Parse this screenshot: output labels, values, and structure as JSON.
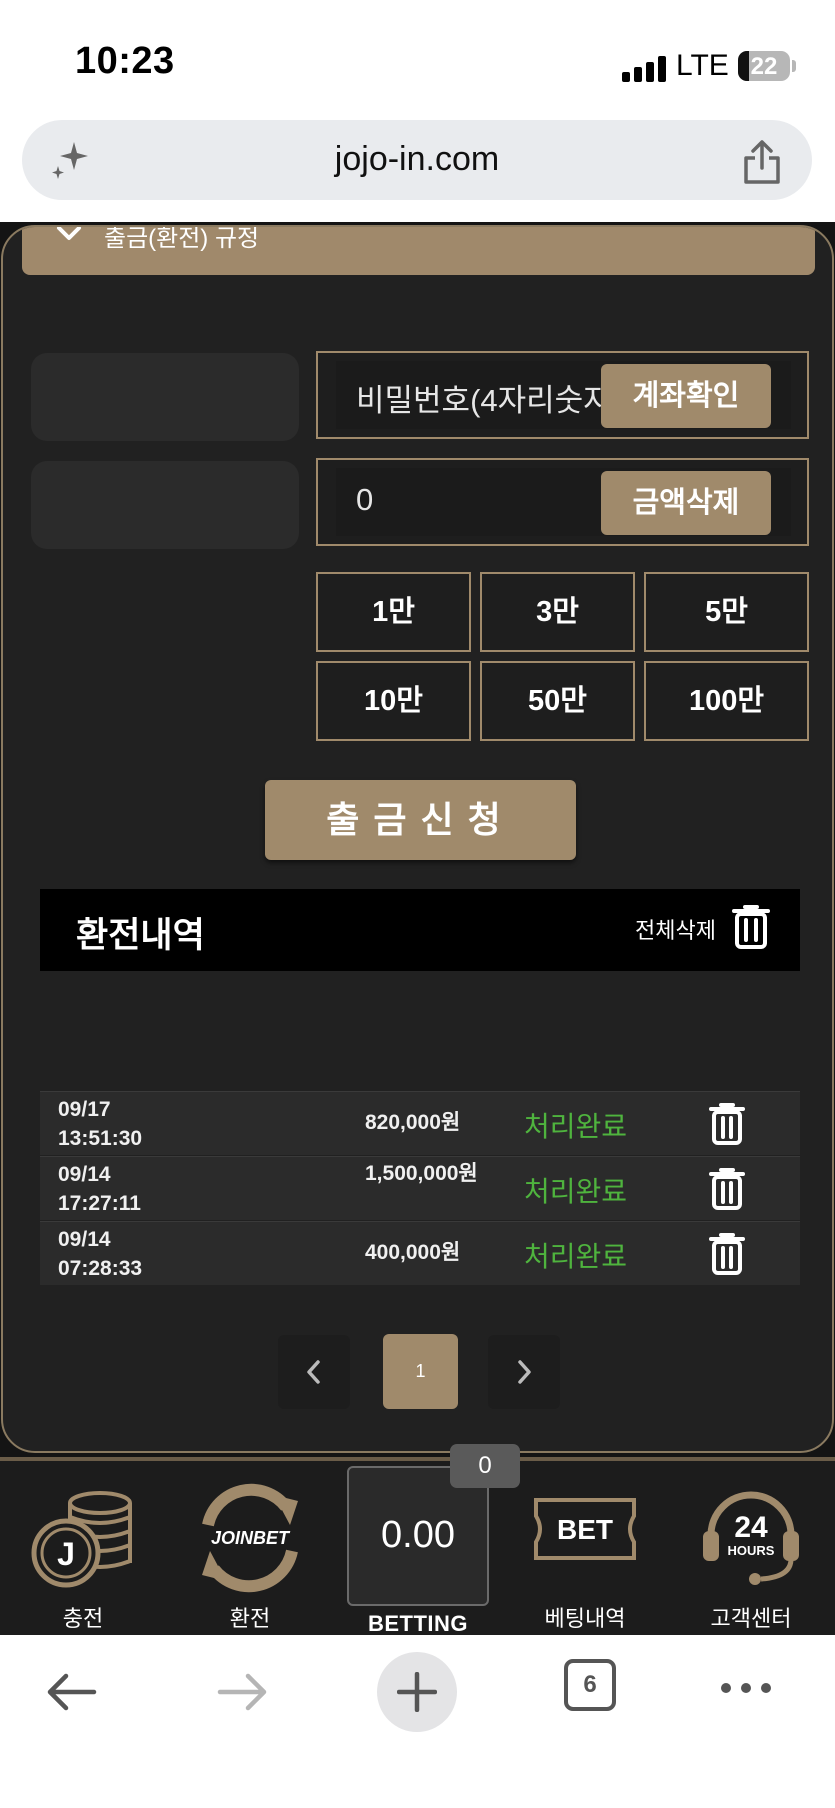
{
  "status_bar": {
    "time": "10:23",
    "network": "LTE",
    "battery": "22",
    "battery_level": 0.22
  },
  "browser": {
    "url": "jojo-in.com"
  },
  "withdraw": {
    "rules_toggle_label": "출금(환전) 규정",
    "password_placeholder": "비밀번호(4자리숫자)",
    "account_check_label": "계좌확인",
    "amount_value": "0",
    "amount_clear_label": "금액삭제",
    "amount_buttons": [
      "1만",
      "3만",
      "5만",
      "10만",
      "50만",
      "100만"
    ],
    "submit_label": "출금신청"
  },
  "history": {
    "title": "환전내역",
    "delete_all_label": "전체삭제",
    "rows": [
      {
        "date": "09/17",
        "time": "13:51:30",
        "amount": "820,000원",
        "status": "처리완료"
      },
      {
        "date": "09/14",
        "time": "17:27:11",
        "amount": "1,500,000원",
        "status": "처리완료"
      },
      {
        "date": "09/14",
        "time": "07:28:33",
        "amount": "400,000원",
        "status": "처리완료"
      }
    ],
    "current_page": "1"
  },
  "bottom_nav": {
    "deposit_label": "충전",
    "exchange_label": "환전",
    "exchange_logo_text": "JOINBET",
    "betting_value": "0.00",
    "betting_label": "BETTING",
    "betting_count": "0",
    "bet_history_icon_text": "BET",
    "bet_history_label": "베팅내역",
    "support_icon_number": "24",
    "support_icon_text": "HOURS",
    "support_label": "고객센터",
    "coin_letter": "J"
  },
  "toolbar": {
    "tab_count": "6"
  },
  "colors": {
    "accent_gold": "#a08a6b",
    "status_green": "#4fb43e",
    "panel_bg": "#212121"
  }
}
